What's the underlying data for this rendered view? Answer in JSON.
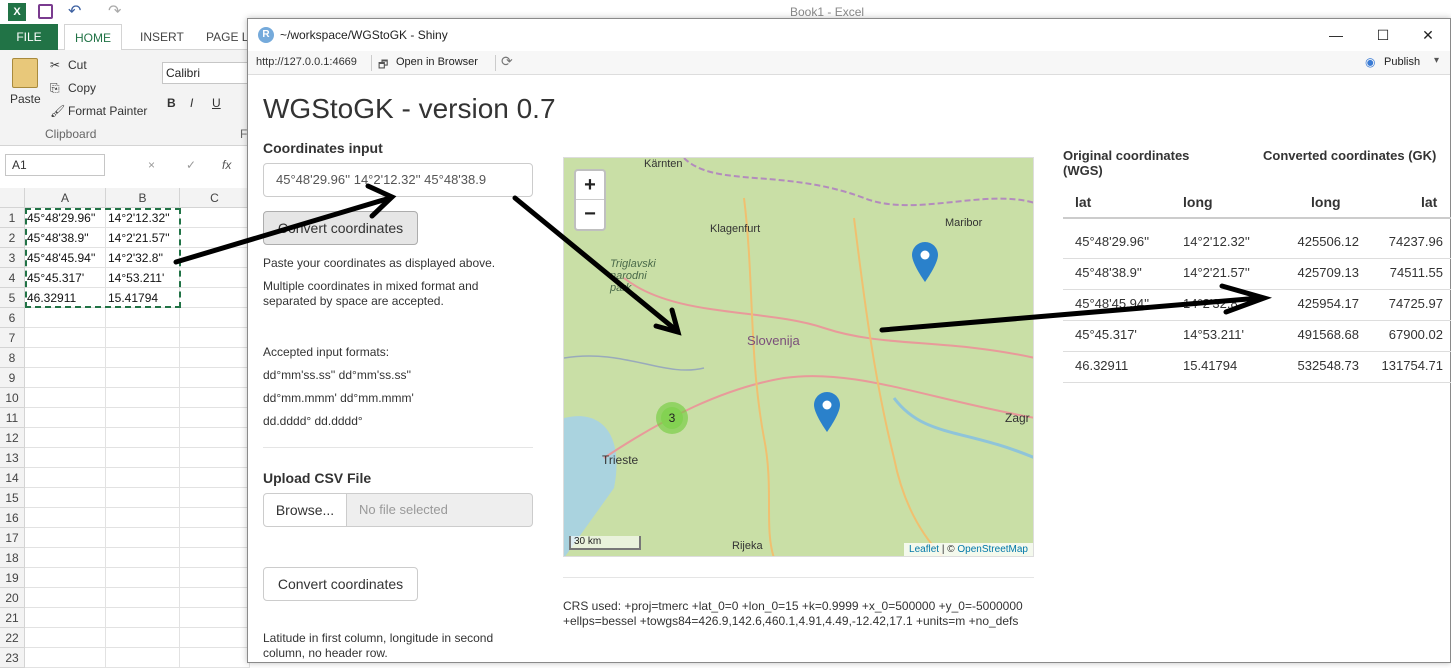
{
  "excel": {
    "window_title": "Book1 - Excel",
    "tabs": [
      "FILE",
      "HOME",
      "INSERT",
      "PAGE LA"
    ],
    "ribbon": {
      "paste": "Paste",
      "cut": "Cut",
      "copy": "Copy",
      "format_painter": "Format Painter",
      "clipboard": "Clipboard",
      "font": "Calibri",
      "bold": "B",
      "italic": "I",
      "underline": "U",
      "font_group_initial": "F"
    },
    "name_box": "A1",
    "formula_icons": [
      "×",
      "✓",
      "fx"
    ],
    "columns": [
      "A",
      "B",
      "C"
    ],
    "rows": [
      "1",
      "2",
      "3",
      "4",
      "5",
      "6",
      "7",
      "8",
      "9",
      "10",
      "11",
      "12",
      "13",
      "14",
      "15",
      "16",
      "17",
      "18",
      "19",
      "20",
      "21",
      "22",
      "23"
    ],
    "cells": [
      [
        "45°48'29.96''",
        "14°2'12.32''"
      ],
      [
        "45°48'38.9''",
        "14°2'21.57''"
      ],
      [
        "45°48'45.94''",
        "14°2'32.8''"
      ],
      [
        "45°45.317'",
        "14°53.211'"
      ],
      [
        "46.32911",
        "15.41794"
      ]
    ]
  },
  "shiny": {
    "window_title": "~/workspace/WGStoGK - Shiny",
    "url": "http://127.0.0.1:4669",
    "open_in_browser": "Open in Browser",
    "publish": "Publish",
    "app_title": "WGStoGK - version 0.7",
    "coords_label": "Coordinates input",
    "coords_value": "45°48'29.96''   14°2'12.32'' 45°48'38.9",
    "convert_button": "Convert coordinates",
    "help1": "Paste your coordinates as displayed above.",
    "help2": "Multiple coordinates in mixed format and separated by space are accepted.",
    "formats_title": "Accepted input formats:",
    "formats": [
      "dd°mm'ss.ss'' dd°mm'ss.ss''",
      "dd°mm.mmm' dd°mm.mmm'",
      "dd.dddd° dd.dddd°"
    ],
    "upload_label": "Upload CSV File",
    "browse_button": "Browse...",
    "file_placeholder": "No file selected",
    "convert_button2": "Convert coordinates",
    "csv_help": "Latitude in first column, longitude in second column, no header row.",
    "crs_text": "CRS used: +proj=tmerc +lat_0=0 +lon_0=15 +k=0.9999 +x_0=500000 +y_0=-5000000 +ellps=bessel +towgs84=426.9,142.6,460.1,4.91,4.49,-12.42,17.1 +units=m +no_defs",
    "map": {
      "zoom_in": "+",
      "zoom_out": "−",
      "labels": [
        "Kärnten",
        "Klagenfurt",
        "Maribor",
        "Triglavski narodni park",
        "Slovenija",
        "Trieste",
        "Rijeka",
        "Zagr"
      ],
      "cluster_count": "3",
      "scale": "30 km",
      "attribution_leaflet": "Leaflet",
      "attribution_sep": " | © ",
      "attribution_osm": "OpenStreetMap"
    },
    "table": {
      "group_headers": [
        "Original coordinates (WGS)",
        "Converted coordinates (GK)"
      ],
      "columns": [
        "lat",
        "long",
        "long",
        "lat"
      ],
      "rows": [
        [
          "45°48'29.96''",
          "14°2'12.32''",
          "425506.12",
          "74237.96"
        ],
        [
          "45°48'38.9''",
          "14°2'21.57''",
          "425709.13",
          "74511.55"
        ],
        [
          "45°48'45.94''",
          "14°2'32.8''",
          "425954.17",
          "74725.97"
        ],
        [
          "45°45.317'",
          "14°53.211'",
          "491568.68",
          "67900.02"
        ],
        [
          "46.32911",
          "15.41794",
          "532548.73",
          "131754.71"
        ]
      ]
    }
  }
}
